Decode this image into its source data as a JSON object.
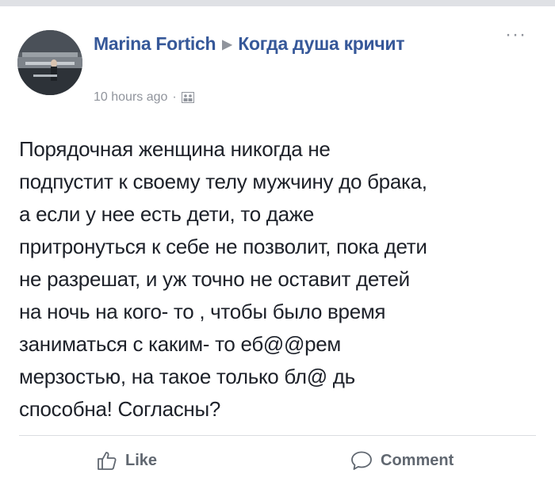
{
  "post": {
    "author": "Marina Fortich",
    "group": "Когда душа кричит",
    "timestamp": "10 hours ago",
    "separator": "·",
    "audience_icon": "group-audience-icon",
    "more_label": "···",
    "text_lines": [
      "Порядочная женщина никогда не",
      "подпустит к своему телу мужчину до брака,",
      "а если у нее есть дети, то даже",
      "притронуться к себе не позволит, пока дети",
      "не разрешат, и уж точно не оставит детей",
      "на ночь на кого- то , чтобы было время",
      "заниматься с каким- то еб@@рем",
      "мерзостью, на такое только бл@ дь",
      "способна! Согласны?"
    ]
  },
  "actions": {
    "like_label": "Like",
    "comment_label": "Comment"
  },
  "colors": {
    "link": "#365899",
    "meta": "#90949c",
    "text": "#1d2129"
  }
}
